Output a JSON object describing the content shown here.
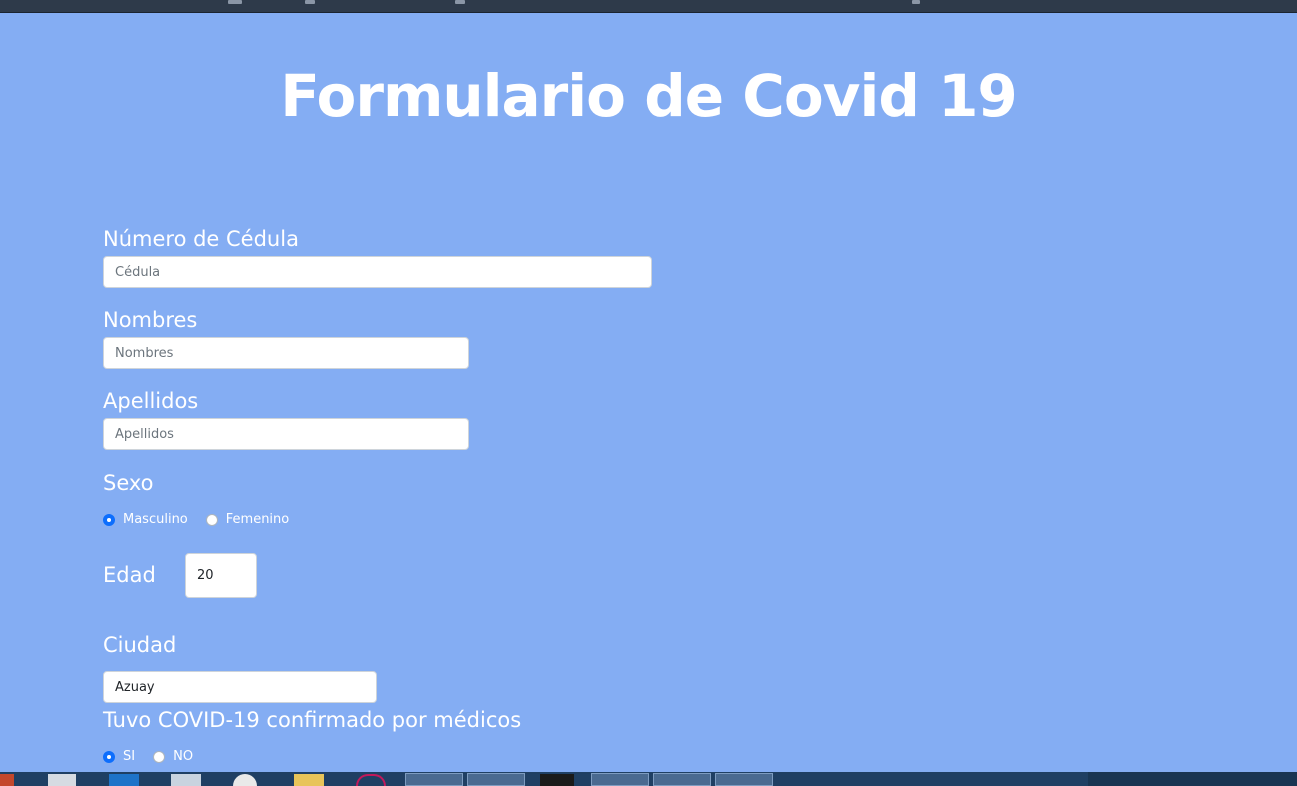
{
  "page": {
    "title": "Formulario de Covid 19"
  },
  "form": {
    "cedula": {
      "label": "Número de Cédula",
      "placeholder": "Cédula",
      "value": ""
    },
    "nombres": {
      "label": "Nombres",
      "placeholder": "Nombres",
      "value": ""
    },
    "apellidos": {
      "label": "Apellidos",
      "placeholder": "Apellidos",
      "value": ""
    },
    "sexo": {
      "label": "Sexo",
      "options": [
        "Masculino",
        "Femenino"
      ],
      "selected": "Masculino"
    },
    "edad": {
      "label": "Edad",
      "value": "20"
    },
    "ciudad": {
      "label": "Ciudad",
      "value": "Azuay"
    },
    "covid": {
      "label": "Tuvo COVID-19 confirmado por médicos",
      "options": [
        "SI",
        "NO"
      ],
      "selected": "SI"
    }
  },
  "colors": {
    "page_background": "#84adf3",
    "radio_checked": "#0d6efd"
  }
}
